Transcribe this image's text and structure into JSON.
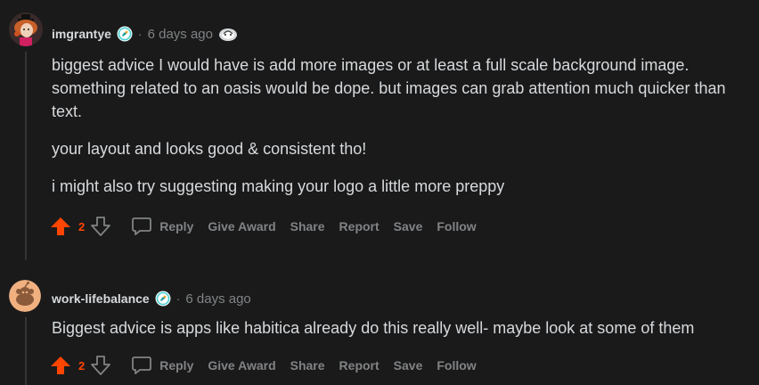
{
  "colors": {
    "background": "#1a1a1b",
    "text": "#d7dadc",
    "muted": "#818384",
    "upvote": "#ff4500"
  },
  "comments": [
    {
      "username": "imgrantye",
      "timestamp": "6 days ago",
      "avatar_icon": "user-avatar-character-icon",
      "flair_icon": "flair-badge-icon",
      "award_icon": "award-icon",
      "paragraphs": [
        "biggest advice I would have is add more images or at least a full scale background image. something related to an oasis would be dope. but images can grab attention much quicker than text.",
        "your layout and looks good & consistent tho!",
        "i might also try suggesting making your logo a little more preppy"
      ],
      "score": "2",
      "actions": {
        "reply": "Reply",
        "give_award": "Give Award",
        "share": "Share",
        "report": "Report",
        "save": "Save",
        "follow": "Follow"
      }
    },
    {
      "username": "work-lifebalance",
      "timestamp": "6 days ago",
      "avatar_icon": "default-snoo-avatar-icon",
      "flair_icon": "flair-badge-icon",
      "paragraphs": [
        "Biggest advice is apps like habitica already do this really well- maybe look at some of them"
      ],
      "score": "2",
      "actions": {
        "reply": "Reply",
        "give_award": "Give Award",
        "share": "Share",
        "report": "Report",
        "save": "Save",
        "follow": "Follow"
      }
    }
  ],
  "separator": "·"
}
